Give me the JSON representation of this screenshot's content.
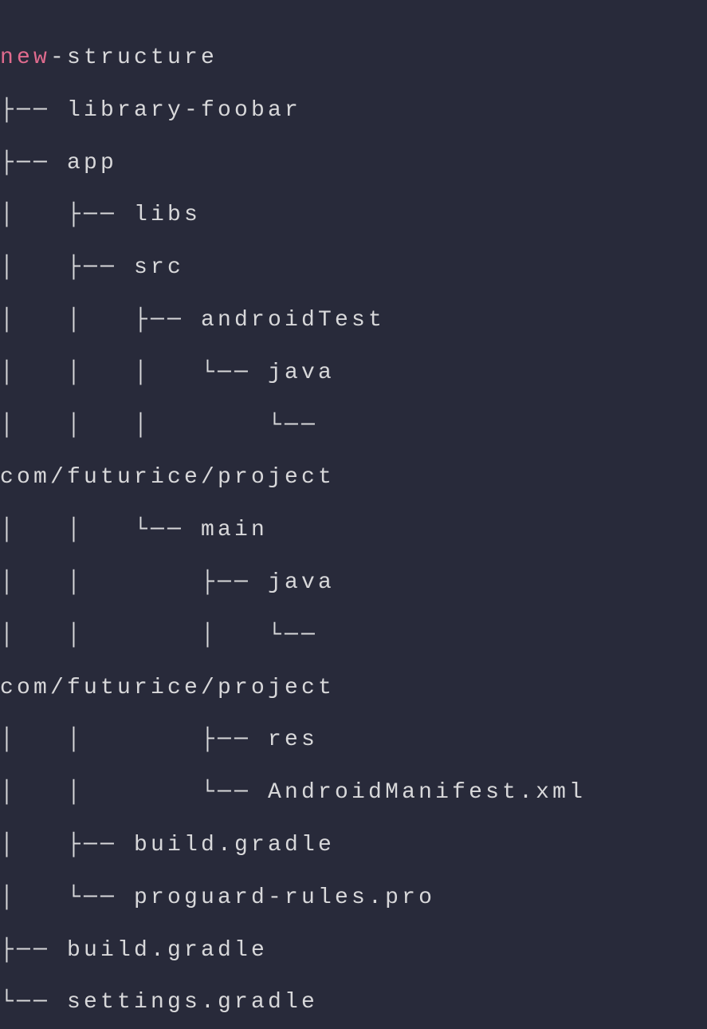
{
  "code": {
    "keyword": "new",
    "rest_of_line1": "-structure",
    "line2": "├── library-foobar",
    "line3": "├── app",
    "line4": "│   ├── libs",
    "line5": "│   ├── src",
    "line6": "│   │   ├── androidTest",
    "line7": "│   │   │   └── java",
    "line8": "│   │   │       └── ",
    "line9": "com/futurice/project",
    "line10": "│   │   └── main",
    "line11": "│   │       ├── java",
    "line12": "│   │       │   └── ",
    "line13": "com/futurice/project",
    "line14": "│   │       ├── res",
    "line15": "│   │       └── AndroidManifest.xml",
    "line16": "│   ├── build.gradle",
    "line17": "│   └── proguard-rules.pro",
    "line18": "├── build.gradle",
    "line19": "└── settings.gradle"
  }
}
